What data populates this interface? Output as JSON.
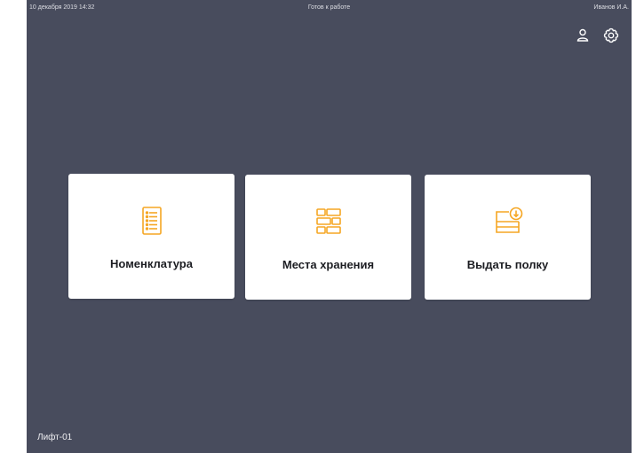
{
  "status": {
    "datetime": "10 декабря 2019 14:32",
    "state": "Готов к работе",
    "user": "Иванов И.А."
  },
  "header": {
    "icons": [
      "user-icon",
      "gear-icon"
    ]
  },
  "cards": [
    {
      "label": "Номенклатура",
      "icon": "list-document-icon"
    },
    {
      "label": "Места хранения",
      "icon": "storage-cells-icon"
    },
    {
      "label": "Выдать полку",
      "icon": "shelf-dispense-icon"
    }
  ],
  "footer": {
    "device": "Лифт-01"
  },
  "colors": {
    "background": "#484c5d",
    "card": "#ffffff",
    "accent": "#f5a623"
  }
}
